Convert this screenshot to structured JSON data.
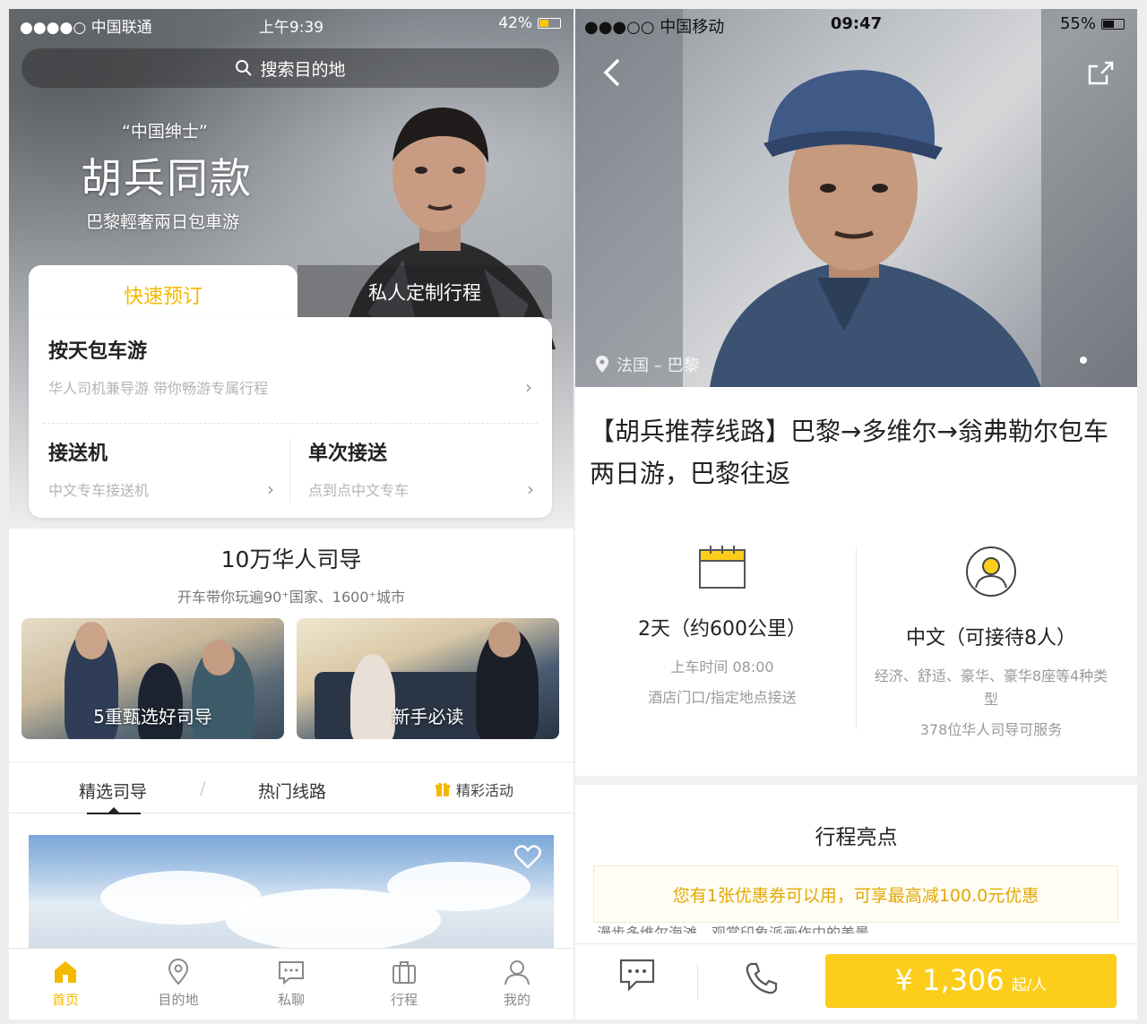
{
  "left": {
    "status": {
      "carrier": "●●●●○ 中国联通",
      "time": "上午9:39",
      "battery": "42%"
    },
    "search": {
      "placeholder": "搜索目的地"
    },
    "promo": {
      "subtitle": "“中国绅士”",
      "title": "胡兵同款",
      "tagline": "巴黎輕奢兩日包車游"
    },
    "booking": {
      "tab_quick": "快速预订",
      "tab_custom": "私人定制行程",
      "daily": {
        "title": "按天包车游",
        "desc": "华人司机兼导游 带你畅游专属行程"
      },
      "transfer": {
        "title": "接送机",
        "desc": "中文专车接送机"
      },
      "single": {
        "title": "单次接送",
        "desc": "点到点中文专车"
      }
    },
    "guides": {
      "title": "10万华人司导",
      "subtitle": "开车带你玩遍90⁺国家、1600⁺城市",
      "card1": "5重甄选好司导",
      "card2": "新手必读"
    },
    "section_tabs": {
      "tab1": "精选司导",
      "separator": "/",
      "tab2": "热门线路",
      "tab3": "精彩活动"
    },
    "nav": [
      {
        "label": "首页",
        "icon": "home-icon",
        "active": true
      },
      {
        "label": "目的地",
        "icon": "location-icon"
      },
      {
        "label": "私聊",
        "icon": "chat-icon"
      },
      {
        "label": "行程",
        "icon": "luggage-icon"
      },
      {
        "label": "我的",
        "icon": "user-icon"
      }
    ],
    "accent": "#f5b800"
  },
  "right": {
    "status": {
      "carrier": "●●●○○ 中国移动",
      "time": "09:47",
      "battery": "55%"
    },
    "location": "法国 – 巴黎",
    "title": "【胡兵推荐线路】巴黎→多维尔→翁弗勒尔包车两日游，巴黎往返",
    "duration": {
      "main": "2天（约600公里）",
      "line1": "上车时间 08:00",
      "line2": "酒店门口/指定地点接送"
    },
    "language": {
      "main": "中文（可接待8人）",
      "line1": "经济、舒适、豪华、豪华8座等4种类型",
      "line2": "378位华人司导可服务"
    },
    "highlights_title": "行程亮点",
    "coupon": "您有1张优惠券可以用，可享最高减100.0元优惠",
    "truncated_text": "漫步多维尔海滩，观赏印象派画作中的美景",
    "price": {
      "amount": "¥ 1,306",
      "unit": "起/人"
    },
    "accent": "#fccd1a"
  }
}
